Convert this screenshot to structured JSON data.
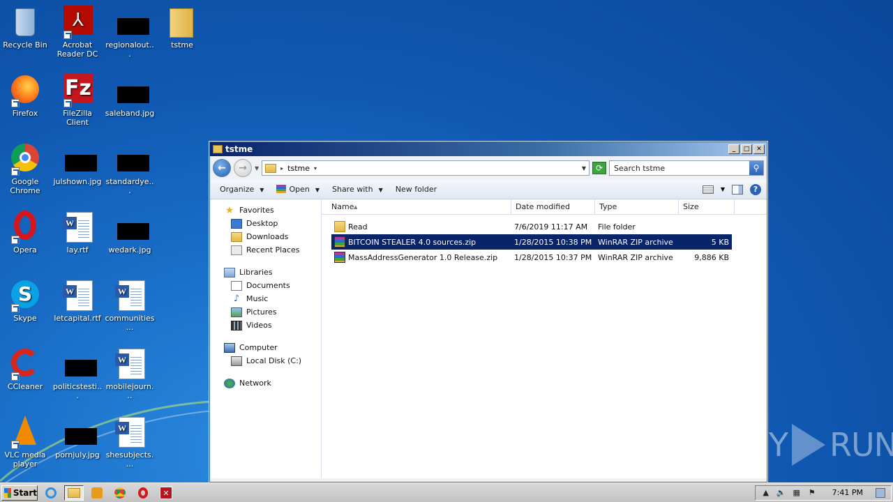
{
  "desktop": {
    "icons": [
      {
        "label": "Recycle Bin",
        "icon": "recycle-bin-icon"
      },
      {
        "label": "Acrobat Reader DC",
        "icon": "acrobat-icon"
      },
      {
        "label": "regionalout...",
        "icon": "image-file-icon"
      },
      {
        "label": "tstme",
        "icon": "folder-icon"
      },
      {
        "label": "Firefox",
        "icon": "firefox-icon"
      },
      {
        "label": "FileZilla Client",
        "icon": "filezilla-icon"
      },
      {
        "label": "saleband.jpg",
        "icon": "image-file-icon"
      },
      {
        "label": "Google Chrome",
        "icon": "chrome-icon"
      },
      {
        "label": "julshown.jpg",
        "icon": "image-file-icon"
      },
      {
        "label": "standardye...",
        "icon": "image-file-icon"
      },
      {
        "label": "Opera",
        "icon": "opera-icon"
      },
      {
        "label": "lay.rtf",
        "icon": "word-document-icon"
      },
      {
        "label": "wedark.jpg",
        "icon": "image-file-icon"
      },
      {
        "label": "Skype",
        "icon": "skype-icon"
      },
      {
        "label": "letcapital.rtf",
        "icon": "word-document-icon"
      },
      {
        "label": "communities...",
        "icon": "word-document-icon"
      },
      {
        "label": "CCleaner",
        "icon": "ccleaner-icon"
      },
      {
        "label": "politicstesti...",
        "icon": "image-file-icon"
      },
      {
        "label": "mobilejourn...",
        "icon": "word-document-icon"
      },
      {
        "label": "VLC media player",
        "icon": "vlc-icon"
      },
      {
        "label": "pornjuly.jpg",
        "icon": "image-file-icon"
      },
      {
        "label": "shesubjects....",
        "icon": "word-document-icon"
      }
    ]
  },
  "window": {
    "title": "tstme",
    "address": {
      "path": "tstme"
    },
    "search": {
      "placeholder": "Search tstme"
    },
    "toolbar": {
      "organize": "Organize",
      "open": "Open",
      "share_with": "Share with",
      "new_folder": "New folder"
    },
    "nav": {
      "favorites": "Favorites",
      "desktop": "Desktop",
      "downloads": "Downloads",
      "recent_places": "Recent Places",
      "libraries": "Libraries",
      "documents": "Documents",
      "music": "Music",
      "pictures": "Pictures",
      "videos": "Videos",
      "computer": "Computer",
      "local_disk": "Local Disk (C:)",
      "network": "Network"
    },
    "columns": {
      "name": "Name",
      "date": "Date modified",
      "type": "Type",
      "size": "Size"
    },
    "files": [
      {
        "name": "Read",
        "date": "7/6/2019 11:17 AM",
        "type": "File folder",
        "size": "",
        "icon": "folder-icon",
        "selected": false
      },
      {
        "name": "BITCOIN STEALER 4.0 sources.zip",
        "date": "1/28/2015 10:38 PM",
        "type": "WinRAR ZIP archive",
        "size": "5 KB",
        "icon": "winrar-icon",
        "selected": true
      },
      {
        "name": "MassAddressGenerator 1.0 Release.zip",
        "date": "1/28/2015 10:37 PM",
        "type": "WinRAR ZIP archive",
        "size": "9,886 KB",
        "icon": "winrar-icon",
        "selected": false
      }
    ]
  },
  "taskbar": {
    "start": "Start",
    "clock": "7:41 PM"
  },
  "watermark": {
    "left": "ANY",
    "right": "RUN"
  }
}
